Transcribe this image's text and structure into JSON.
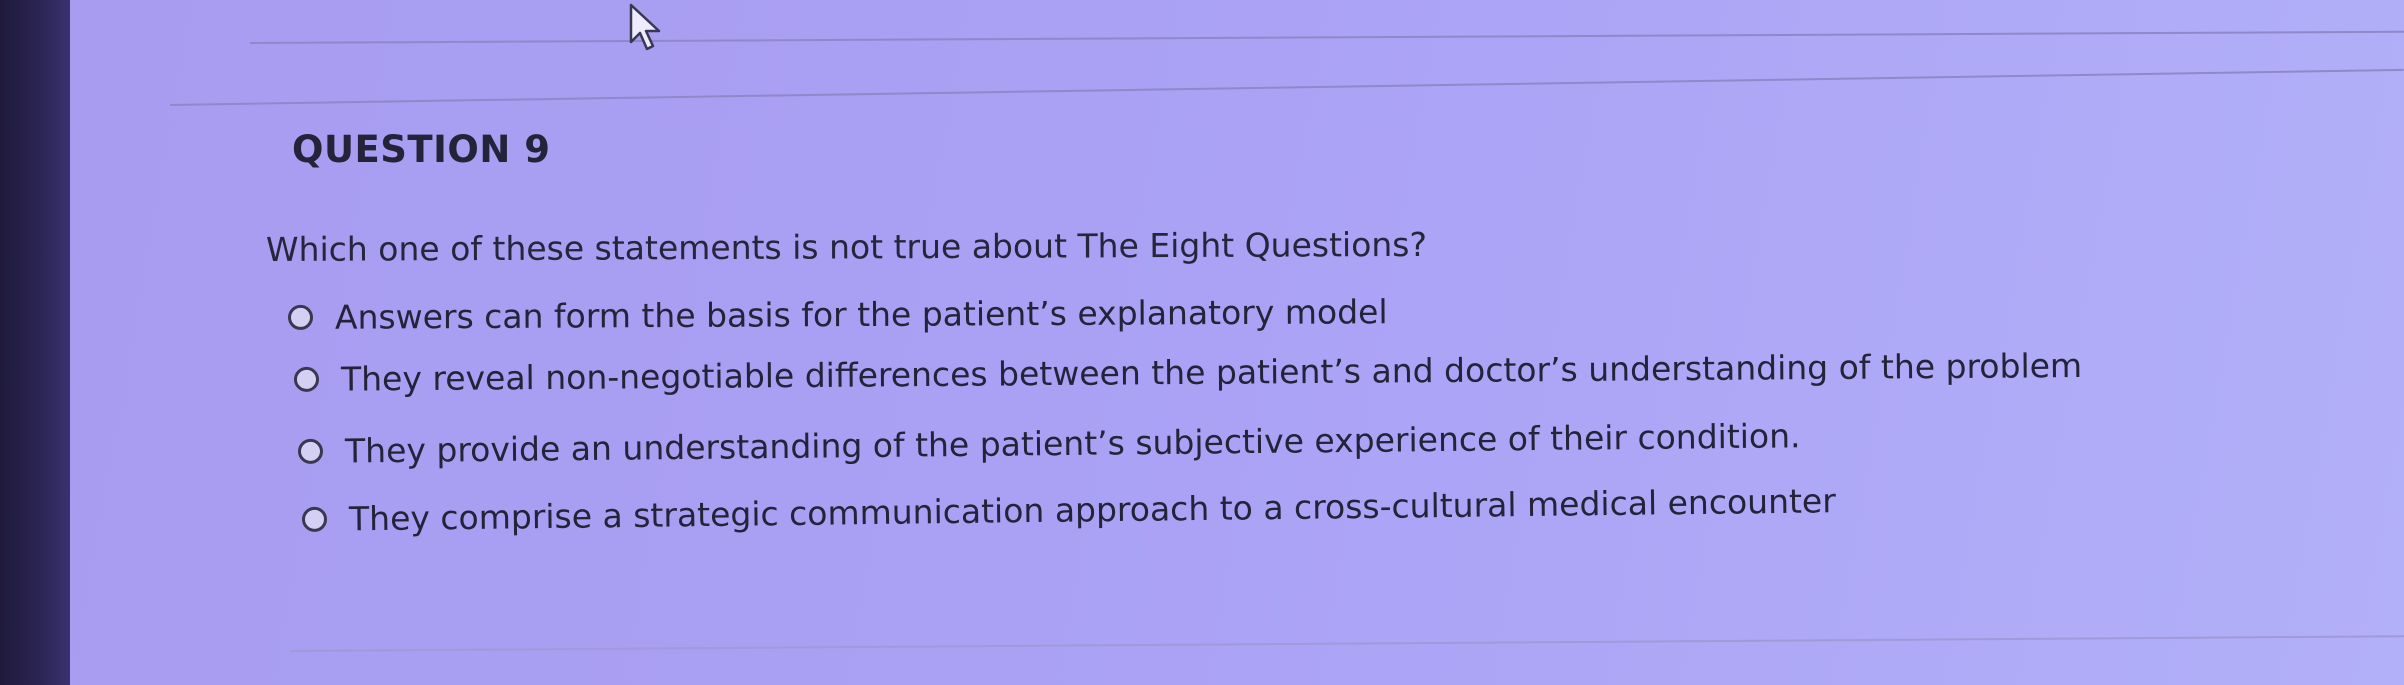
{
  "question": {
    "number_label": "QUESTION 9",
    "prompt": "Which one of these statements is not true about The Eight Questions?",
    "options": [
      {
        "label": "Answers can form the basis for the patient’s explanatory model",
        "selected": false
      },
      {
        "label": "They reveal non-negotiable differences between the patient’s and doctor’s understanding of the problem",
        "selected": false
      },
      {
        "label": "They provide an understanding of the patient’s subjective experience of their condition.",
        "selected": false
      },
      {
        "label": "They comprise a strategic communication approach to a cross-cultural medical encounter",
        "selected": false
      }
    ]
  },
  "colors": {
    "background": "#a99ff3",
    "text": "#25233a",
    "divider": "#8f88c9"
  },
  "icons": {
    "cursor": "mouse-pointer-icon",
    "radio": "radio-button-unselected"
  }
}
